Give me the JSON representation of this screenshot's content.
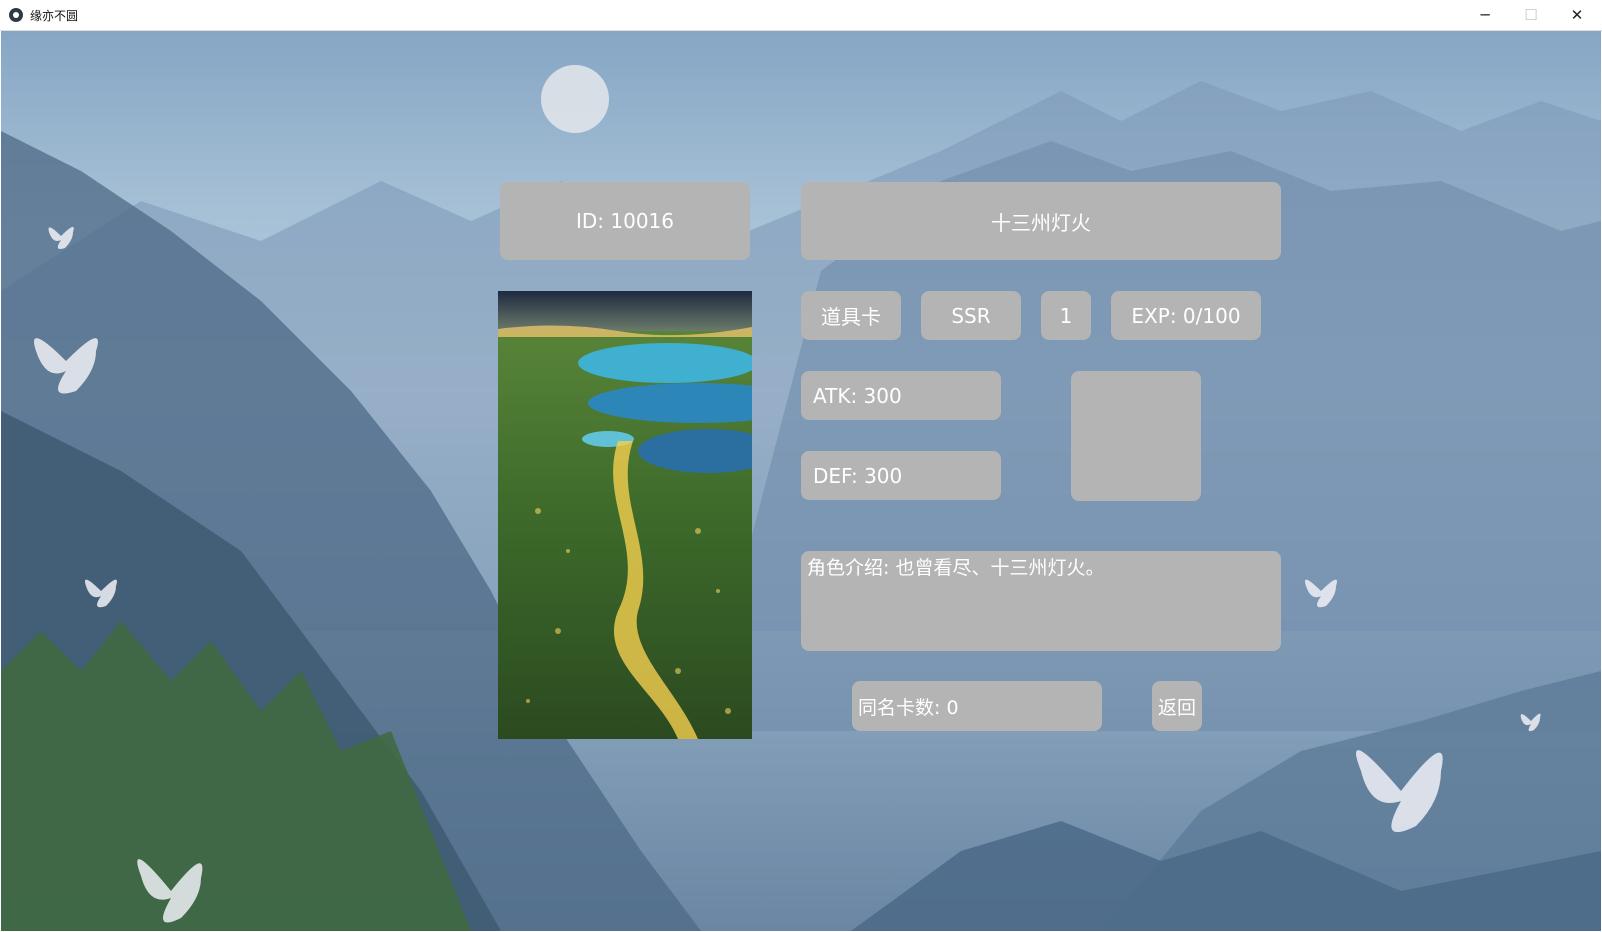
{
  "window": {
    "title": "缘亦不圆",
    "minimize_icon": "minimize-icon",
    "maximize_icon": "maximize-icon",
    "close_icon": "close-icon",
    "minimize_glyph": "─",
    "maximize_glyph": "☐",
    "close_glyph": "✕"
  },
  "card": {
    "id_text": "ID:   10016",
    "name": "十三州灯火",
    "type": "道具卡",
    "rarity": "SSR",
    "level": "1",
    "exp": "EXP: 0/100",
    "atk": "ATK: 300",
    "def": "DEF: 300",
    "description": "角色介绍: 也曾看尽、十三州灯火。",
    "duplicates": "同名卡数: 0",
    "back_label": "返回"
  },
  "colors": {
    "panel": "#b4b4b4",
    "panel_text": "#ffffff"
  }
}
